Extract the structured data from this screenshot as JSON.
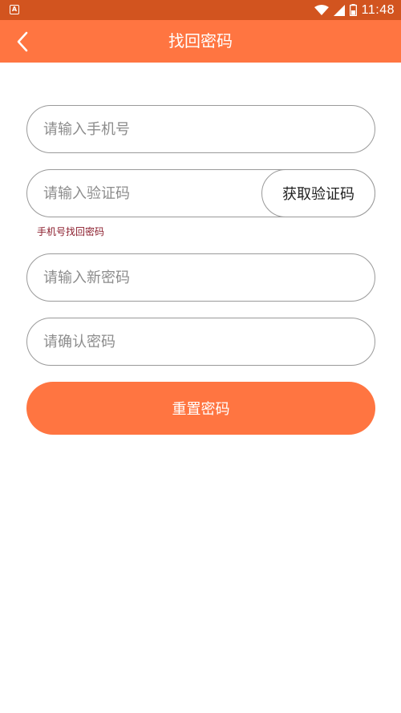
{
  "status_bar": {
    "time": "11:48",
    "icons": [
      "app-notification-icon",
      "wifi-icon",
      "signal-icon",
      "battery-icon"
    ]
  },
  "app_bar": {
    "title": "找回密码",
    "back_icon": "chevron-left-icon"
  },
  "form": {
    "phone_placeholder": "请输入手机号",
    "code_placeholder": "请输入验证码",
    "get_code_label": "获取验证码",
    "hint_link": "手机号找回密码",
    "new_password_placeholder": "请输入新密码",
    "confirm_password_placeholder": "请确认密码",
    "submit_label": "重置密码"
  },
  "colors": {
    "status_bar": "#d2541f",
    "accent": "#ff7541",
    "hint_text": "#8b1d2c",
    "field_border": "#9a9a9a"
  }
}
